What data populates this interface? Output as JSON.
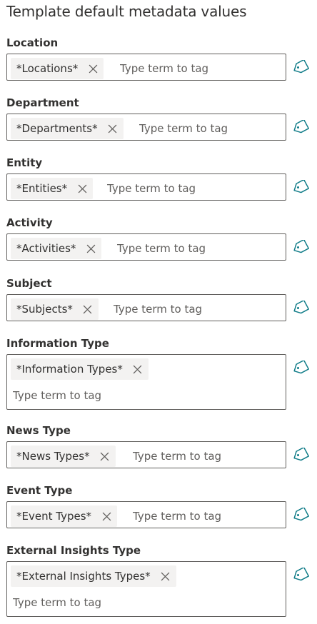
{
  "page": {
    "title": "Template default metadata values"
  },
  "common": {
    "input_placeholder": "Type term to tag",
    "icons": {
      "remove": "close-icon",
      "tag": "tag-icon"
    }
  },
  "fields": [
    {
      "label": "Location",
      "term": "*Locations*"
    },
    {
      "label": "Department",
      "term": "*Departments*"
    },
    {
      "label": "Entity",
      "term": "*Entities*"
    },
    {
      "label": "Activity",
      "term": "*Activities*"
    },
    {
      "label": "Subject",
      "term": "*Subjects*"
    },
    {
      "label": "Information Type",
      "term": "*Information Types*"
    },
    {
      "label": "News Type",
      "term": "*News Types*"
    },
    {
      "label": "Event Type",
      "term": "*Event Types*"
    },
    {
      "label": "External Insights Type",
      "term": "*External Insights Types*"
    }
  ]
}
